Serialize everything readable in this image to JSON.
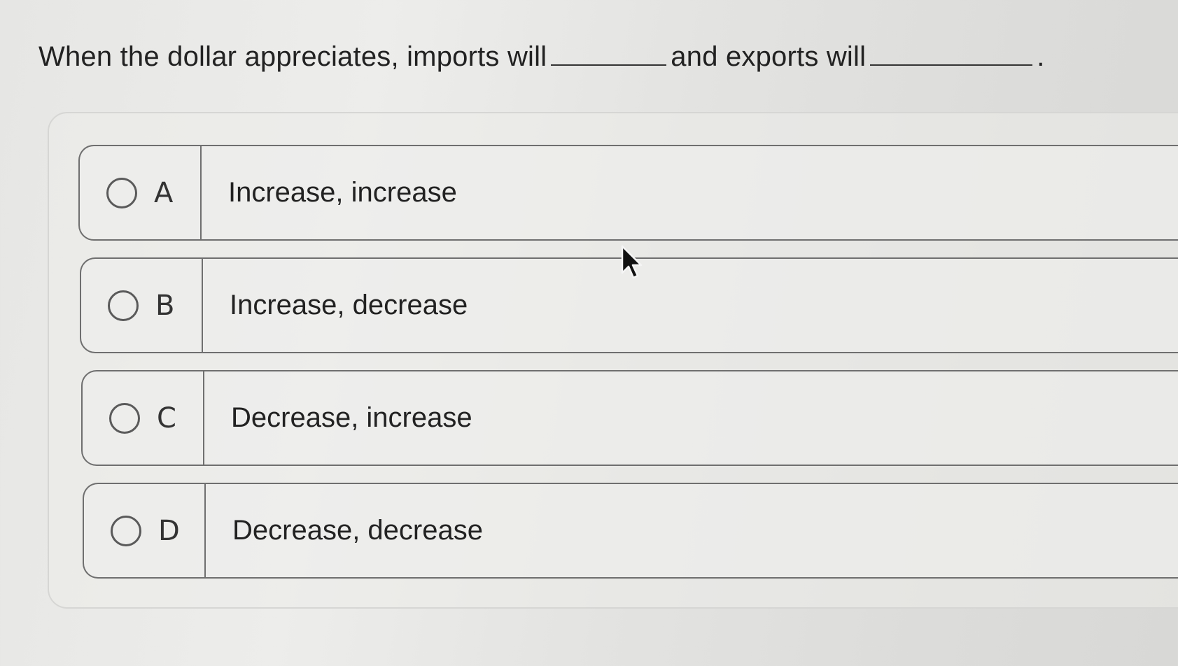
{
  "question": {
    "part1": "When the dollar appreciates, imports will",
    "part2": "and exports will",
    "part3": "."
  },
  "choices": [
    {
      "letter": "A",
      "text": "Increase, increase"
    },
    {
      "letter": "B",
      "text": "Increase, decrease"
    },
    {
      "letter": "C",
      "text": "Decrease, increase"
    },
    {
      "letter": "D",
      "text": "Decrease, decrease"
    }
  ],
  "icons": {
    "radio": "radio-unselected-icon",
    "cursor": "mouse-pointer-icon"
  }
}
